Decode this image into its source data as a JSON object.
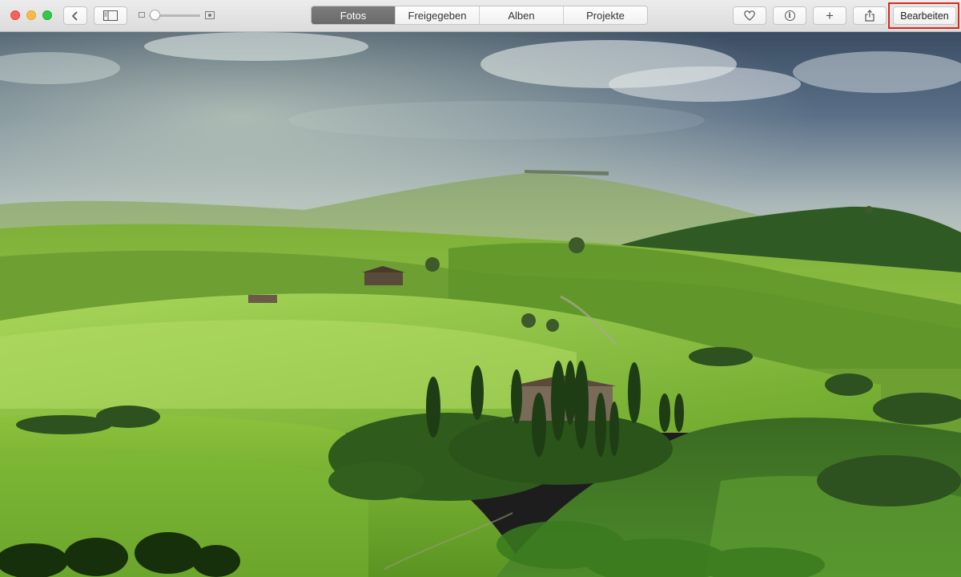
{
  "window": {
    "controls": [
      "close",
      "minimize",
      "zoom"
    ]
  },
  "toolbar": {
    "back_icon": "chevron-left-icon",
    "sidebar_icon": "sidebar-icon",
    "zoom_slider": {
      "level": 0.0
    },
    "tabs": [
      {
        "label": "Fotos",
        "selected": true
      },
      {
        "label": "Freigegeben",
        "selected": false
      },
      {
        "label": "Alben",
        "selected": false
      },
      {
        "label": "Projekte",
        "selected": false
      }
    ],
    "favorite_icon": "heart-icon",
    "info_icon": "info-icon",
    "add_label": "+",
    "share_icon": "share-icon",
    "edit_label": "Bearbeiten",
    "highlight_color": "#e0261e"
  },
  "photo": {
    "subject": "tuscany-landscape"
  }
}
